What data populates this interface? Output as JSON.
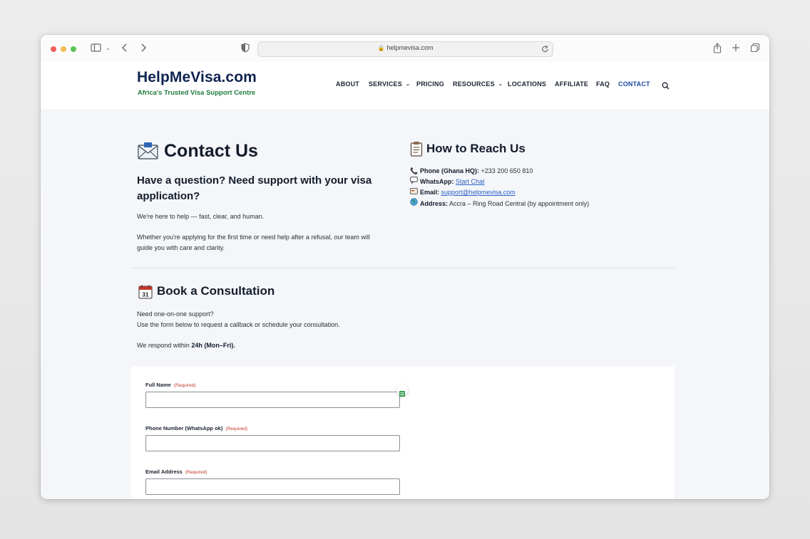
{
  "browser": {
    "url": "helpmevisa.com"
  },
  "site": {
    "logo": "HelpMeVisa.com",
    "tagline": "Africa's Trusted Visa Support Centre",
    "nav": [
      "ABOUT",
      "SERVICES",
      "PRICING",
      "RESOURCES",
      "LOCATIONS",
      "AFFILIATE",
      "FAQ",
      "CONTACT"
    ],
    "active_nav": "CONTACT"
  },
  "contact": {
    "title": "Contact Us",
    "question": "Have a question? Need support with your visa application?",
    "para1": "We're here to help — fast, clear, and human.",
    "para2": "Whether you're applying for the first time or need help after a refusal, our team will guide you with care and clarity."
  },
  "reach": {
    "title": "How to Reach Us",
    "phone_label": "Phone (Ghana HQ):",
    "phone_value": "+233 200 650 810",
    "whatsapp_label": "WhatsApp:",
    "whatsapp_link": "Start Chat",
    "email_label": "Email:",
    "email_link": "support@helpmevisa.com",
    "address_label": "Address:",
    "address_value": "Accra – Ring Road Central (by appointment only)"
  },
  "booking": {
    "title": "Book a Consultation",
    "line1": "Need one-on-one support?",
    "line2": "Use the form below to request a callback or schedule your consultation.",
    "respond_prefix": "We respond within",
    "respond_bold": "24h (Mon–Fri)."
  },
  "form": {
    "required_text": "(Required)",
    "fields": [
      {
        "label": "Full Name",
        "value": ""
      },
      {
        "label": "Phone Number (WhatsApp ok)",
        "value": ""
      },
      {
        "label": "Email Address",
        "value": ""
      }
    ]
  },
  "colors": {
    "brand_navy": "#0f2350",
    "brand_green": "#1f7a3e",
    "link_blue": "#2b5fc7",
    "required_red": "#c0392b"
  },
  "icons": {
    "contact_title": "envelope-icon",
    "reach_title": "clipboard-icon",
    "phone": "phone-icon",
    "whatsapp": "chat-bubble-icon",
    "email": "email-icon",
    "address": "globe-icon",
    "booking_title": "calendar-icon"
  }
}
